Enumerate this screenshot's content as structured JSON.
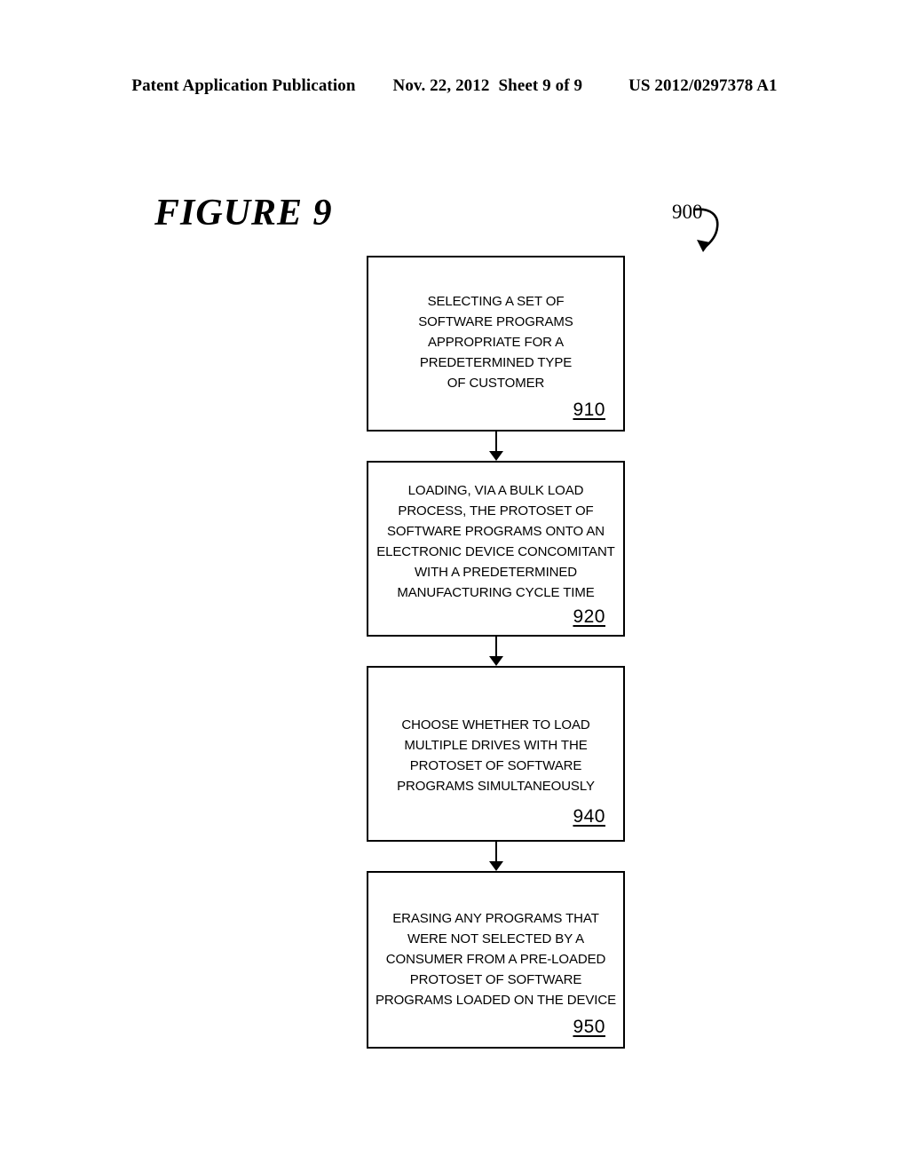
{
  "header": {
    "publication": "Patent Application Publication",
    "date": "Nov. 22, 2012",
    "sheet": "Sheet 9 of 9",
    "number": "US 2012/0297378 A1"
  },
  "figure": {
    "caption": "FIGURE 9",
    "reference_numeral": "900",
    "reference_arrow_icon": "curved-arrow-icon"
  },
  "flowchart": {
    "orientation": "vertical",
    "connector_icon": "down-arrow-icon",
    "nodes": [
      {
        "id": "910",
        "number": "910",
        "lines": [
          "SELECTING A SET OF",
          "SOFTWARE PROGRAMS",
          "APPROPRIATE FOR A",
          "PREDETERMINED TYPE",
          "OF CUSTOMER"
        ]
      },
      {
        "id": "920",
        "number": "920",
        "lines": [
          "LOADING, VIA A BULK LOAD",
          "PROCESS, THE PROTOSET OF",
          "SOFTWARE PROGRAMS ONTO AN",
          "ELECTRONIC DEVICE CONCOMITANT",
          "WITH A PREDETERMINED",
          "MANUFACTURING CYCLE TIME"
        ]
      },
      {
        "id": "940",
        "number": "940",
        "lines": [
          "CHOOSE WHETHER TO LOAD",
          "MULTIPLE DRIVES WITH THE",
          "PROTOSET OF SOFTWARE",
          "PROGRAMS SIMULTANEOUSLY"
        ]
      },
      {
        "id": "950",
        "number": "950",
        "lines": [
          "ERASING ANY PROGRAMS THAT",
          "WERE NOT SELECTED BY A",
          "CONSUMER FROM A PRE-LOADED",
          "PROTOSET OF SOFTWARE",
          "PROGRAMS LOADED ON THE DEVICE"
        ]
      }
    ]
  },
  "colors": {
    "page_background": "#ffffff",
    "ink": "#000000"
  }
}
